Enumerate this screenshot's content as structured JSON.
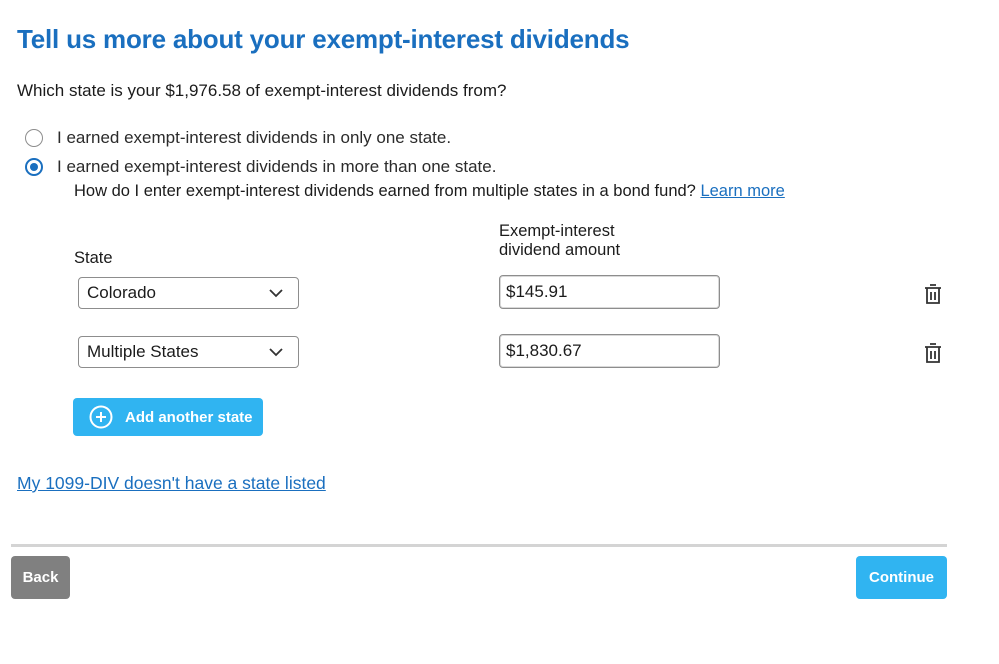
{
  "page": {
    "title": "Tell us more about your exempt-interest dividends",
    "question": "Which state is your $1,976.58 of exempt-interest dividends from?"
  },
  "options": [
    {
      "label": "I earned exempt-interest dividends in only one state.",
      "selected": false
    },
    {
      "label": "I earned exempt-interest dividends in more than one state.",
      "selected": true
    }
  ],
  "help": {
    "text": "How do I enter exempt-interest dividends earned from multiple states in a bond fund? ",
    "link": "Learn more"
  },
  "table": {
    "state_header": "State",
    "amount_header_line1": "Exempt-interest",
    "amount_header_line2": "dividend amount",
    "rows": [
      {
        "state": "Colorado",
        "amount": "$145.91"
      },
      {
        "state": "Multiple States",
        "amount": "$1,830.67"
      }
    ]
  },
  "actions": {
    "add_state": "Add another state",
    "no_state_link": "My 1099-DIV doesn't have a state listed",
    "back": "Back",
    "continue": "Continue"
  },
  "icons": {
    "radio": "radio-icon",
    "chevron": "chevron-down-icon",
    "trash": "trash-icon",
    "add": "plus-circle-icon"
  },
  "colors": {
    "primary_blue": "#1a6fbf",
    "button_blue": "#30b4f1",
    "back_gray": "#808080"
  }
}
